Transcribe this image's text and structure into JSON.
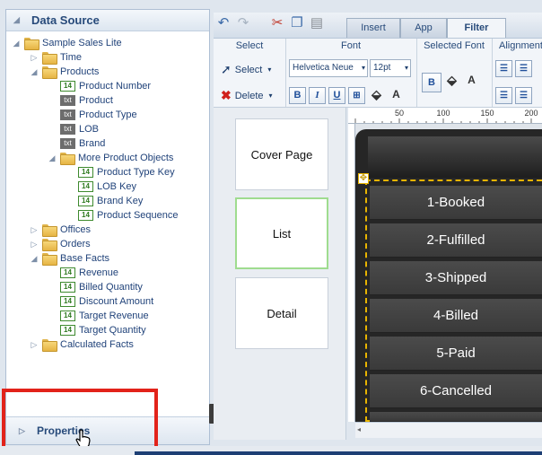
{
  "data_source": {
    "title": "Data Source",
    "tree": [
      {
        "label": "Sample Sales Lite",
        "type": "folder",
        "expander": "expanded"
      },
      {
        "label": "Time",
        "type": "folder",
        "expander": "collapsed"
      },
      {
        "label": "Products",
        "type": "folder",
        "expander": "expanded"
      },
      {
        "label": "Product Number",
        "type": "numeric"
      },
      {
        "label": "Product",
        "type": "text"
      },
      {
        "label": "Product Type",
        "type": "text"
      },
      {
        "label": "LOB",
        "type": "text"
      },
      {
        "label": "Brand",
        "type": "text"
      },
      {
        "label": "More Product Objects",
        "type": "folder",
        "expander": "expanded"
      },
      {
        "label": "Product Type Key",
        "type": "numeric"
      },
      {
        "label": "LOB Key",
        "type": "numeric"
      },
      {
        "label": "Brand Key",
        "type": "numeric"
      },
      {
        "label": "Product Sequence",
        "type": "numeric"
      },
      {
        "label": "Offices",
        "type": "folder",
        "expander": "collapsed"
      },
      {
        "label": "Orders",
        "type": "folder",
        "expander": "collapsed"
      },
      {
        "label": "Base Facts",
        "type": "folder",
        "expander": "expanded"
      },
      {
        "label": "Revenue",
        "type": "numeric"
      },
      {
        "label": "Billed Quantity",
        "type": "numeric"
      },
      {
        "label": "Discount Amount",
        "type": "numeric"
      },
      {
        "label": "Target Revenue",
        "type": "numeric"
      },
      {
        "label": "Target Quantity",
        "type": "numeric"
      },
      {
        "label": "Calculated Facts",
        "type": "folder",
        "expander": "collapsed"
      }
    ],
    "numeric_badge": "14",
    "text_badge": "txt"
  },
  "properties": {
    "title": "Properties"
  },
  "toolbar": {
    "tabs": [
      "Insert",
      "App",
      "Filter"
    ],
    "active_tab": "Filter"
  },
  "ribbon": {
    "select_group": {
      "title": "Select",
      "select_label": "Select",
      "delete_label": "Delete"
    },
    "font_group": {
      "title": "Font",
      "font_name": "Helvetica Neue",
      "font_size": "12pt",
      "bold": "B",
      "italic": "I",
      "underline": "U"
    },
    "selected_font_group": {
      "title": "Selected Font",
      "bold": "B"
    },
    "alignment_group": {
      "title": "Alignment"
    }
  },
  "pages": [
    "Cover Page",
    "List",
    "Detail"
  ],
  "selected_page": "List",
  "ruler": {
    "labels": [
      "50",
      "100",
      "150",
      "200"
    ]
  },
  "list_rows": [
    "1-Booked",
    "2-Fulfilled",
    "3-Shipped",
    "4-Billed",
    "5-Paid",
    "6-Cancelled"
  ],
  "colors": {
    "highlight": "#e2231a",
    "selection_dash": "#e8b400",
    "selected_page_border": "#9fdc8f"
  }
}
